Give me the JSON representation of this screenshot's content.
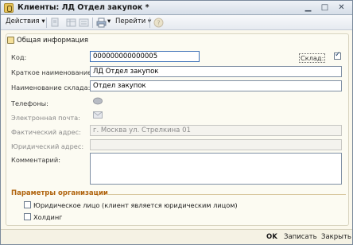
{
  "window": {
    "title": "Клиенты: ЛД Отдел закупок *"
  },
  "toolbar": {
    "actions_label": "Действия",
    "goto_label": "Перейти"
  },
  "tab": {
    "label": "Общая информация"
  },
  "fields": {
    "code_label": "Код:",
    "code_value": "000000000000005",
    "warehouse_label": "Склад:",
    "warehouse_checked": true,
    "short_name_label": "Краткое наименование",
    "short_name_value": "ЛД Отдел закупок",
    "warehouse_name_label": "Наименование склада:",
    "warehouse_name_value": "Отдел закупок",
    "phones_label": "Телефоны:",
    "email_label": "Электронная почта:",
    "actual_address_label": "Фактический адрес:",
    "actual_address_value": "г. Москва ул. Стрелкина 01",
    "legal_address_label": "Юридический адрес:",
    "comment_label": "Комментарий:"
  },
  "org_params": {
    "title": "Параметры организации",
    "legal_entity_label": "Юридическое лицо (клиент является юридическим лицом)",
    "legal_entity_checked": false,
    "holding_label": "Холдинг",
    "holding_checked": false
  },
  "footer": {
    "ok_label": "OK",
    "save_label": "Записать",
    "close_label": "Закрыть"
  }
}
